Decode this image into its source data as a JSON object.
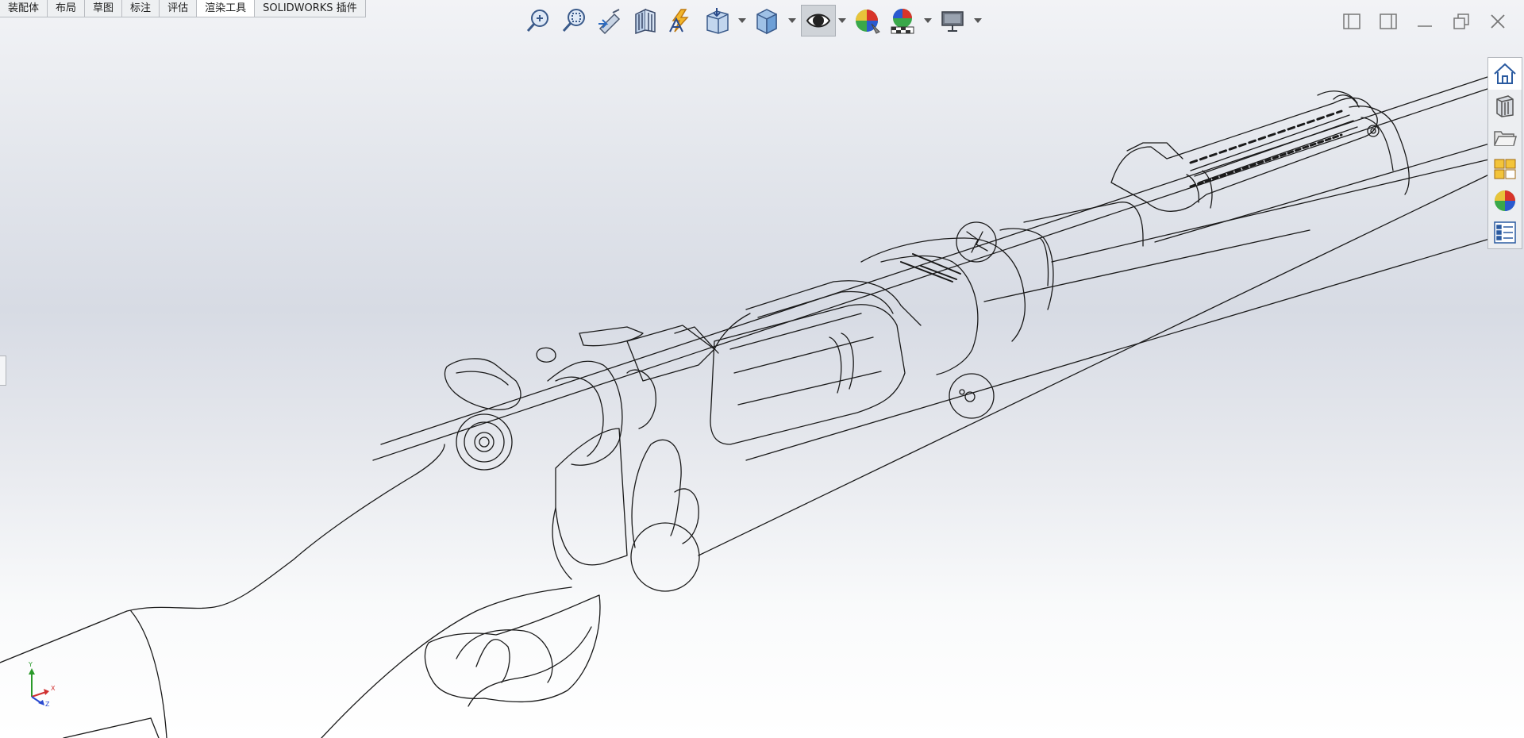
{
  "tabs": [
    {
      "label": "装配体",
      "active": false
    },
    {
      "label": "布局",
      "active": false
    },
    {
      "label": "草图",
      "active": false
    },
    {
      "label": "标注",
      "active": false
    },
    {
      "label": "评估",
      "active": false
    },
    {
      "label": "渲染工具",
      "active": true
    },
    {
      "label": "SOLIDWORKS 插件",
      "active": false
    }
  ],
  "heads_up_toolbar": [
    {
      "icon": "zoom-to-fit-icon"
    },
    {
      "icon": "zoom-to-area-icon"
    },
    {
      "icon": "previous-view-icon"
    },
    {
      "icon": "section-view-icon"
    },
    {
      "icon": "dynamic-annotation-views-icon"
    },
    {
      "icon": "view-orientation-icon",
      "dropdown": true
    },
    {
      "icon": "display-style-icon",
      "dropdown": true
    },
    {
      "icon": "hide-show-items-icon",
      "dropdown": true,
      "pressed": true
    },
    {
      "icon": "edit-appearance-icon"
    },
    {
      "icon": "apply-scene-icon",
      "dropdown": true
    },
    {
      "icon": "view-settings-icon",
      "dropdown": true
    }
  ],
  "window_controls": [
    {
      "icon": "tile-left-icon"
    },
    {
      "icon": "tile-right-icon"
    },
    {
      "icon": "minimize-icon"
    },
    {
      "icon": "restore-icon"
    },
    {
      "icon": "close-icon"
    }
  ],
  "task_pane": [
    {
      "icon": "solidworks-resources-icon",
      "active": true
    },
    {
      "icon": "design-library-icon"
    },
    {
      "icon": "file-explorer-icon"
    },
    {
      "icon": "view-palette-icon"
    },
    {
      "icon": "appearances-scenes-icon"
    },
    {
      "icon": "custom-properties-icon"
    }
  ],
  "triad": {
    "x": "X",
    "y": "Y",
    "z": "Z"
  },
  "colors": {
    "tab_bg": "#eef0f2",
    "tab_active_bg": "#ffffff",
    "tab_border": "#b9bcc1",
    "model_line": "#1a1a1a",
    "triad_x": "#d03030",
    "triad_y": "#2a9a2a",
    "triad_z": "#2a4ad0"
  }
}
